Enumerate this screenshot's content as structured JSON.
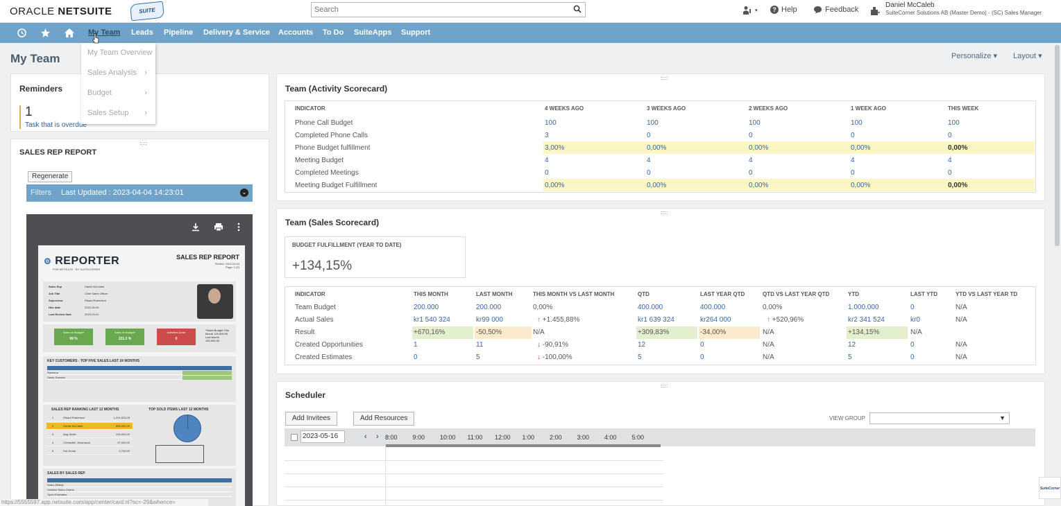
{
  "header": {
    "brand_oracle": "ORACLE",
    "brand_netsuite": "NETSUITE",
    "brand_partner": "SUITE CORNER",
    "search_placeholder": "Search",
    "help_label": "Help",
    "feedback_label": "Feedback",
    "user_name": "Daniel McCaleb",
    "user_role": "SuiteCorner Solutions AB (Master Demo) - (SC) Sales Manager"
  },
  "nav": {
    "items": [
      "My Team",
      "Leads",
      "Pipeline",
      "Delivery & Service",
      "Accounts",
      "To Do",
      "SuiteApps",
      "Support"
    ],
    "dropdown": [
      "My Team Overview",
      "Sales Analysis",
      "Budget",
      "Sales Setup"
    ]
  },
  "page": {
    "title": "My Team",
    "personalize": "Personalize",
    "layout": "Layout"
  },
  "reminders": {
    "title": "Reminders",
    "count": "1",
    "text": "Task that is overdue"
  },
  "sales_rep_report": {
    "title": "SALES REP REPORT",
    "regenerate": "Regenerate",
    "filters": "Filters",
    "last_updated": "Last Updated : 2023-04-04 14:23:01",
    "doc": {
      "logo": "REPORTER",
      "logo_sub": "FOR NETSUITE · BY SUITECORNER",
      "title": "SALES REP REPORT",
      "meta_printed": "Printed: 2023-04-04",
      "meta_page": "Page: 1 (2)",
      "info": [
        {
          "k": "Sales Rep",
          "v": "Daniel McCaleb"
        },
        {
          "k": "Job Title",
          "v": "Chief Sales Officer"
        },
        {
          "k": "Supervisor",
          "v": "Rikard Robertson"
        },
        {
          "k": "Hire date",
          "v": "2022-05-29"
        },
        {
          "k": "Last Review Date",
          "v": "2023-03-01"
        }
      ],
      "kpis": [
        {
          "label": "Sales vs Budget*",
          "value": "99 %",
          "color": "#6aa84f"
        },
        {
          "label": "Sales vs Budget*",
          "value": "221.3 %",
          "color": "#6aa84f"
        },
        {
          "label": "Activities Done",
          "value": "0",
          "color": "#cc4b4b"
        }
      ],
      "kpi_note": "*Sales Budget This Month 120,000.00 Last Month 100,000.00",
      "customers_title": "KEY CUSTOMERS - TOP FIVE SALES LAST 24 MONTHS",
      "customers": [
        "Sanmina",
        "Sarah Samson"
      ],
      "ranking_title": "SALES REP RANKING LAST 12 MONTHS",
      "ranking": [
        {
          "n": "1",
          "name": "Rikard Robertson",
          "val": "1,204,523.28"
        },
        {
          "n": "2",
          "name": "Daniel McCaleb",
          "val": "855,000.00"
        },
        {
          "n": "3",
          "name": "Bog Smith",
          "val": "225,000.00"
        },
        {
          "n": "4",
          "name": "Christoffer Johansson",
          "val": "97,000.00"
        },
        {
          "n": "5",
          "name": "Kai Grune",
          "val": "3,700.00"
        }
      ],
      "top_items_title": "TOP SOLD ITEMS LAST 12 MONTHS",
      "by_rep_title": "SALES BY SALES REP",
      "by_rep_rows": [
        "Sales (Billed)",
        "Unbilled Sales Orders",
        "Open Estimates"
      ]
    }
  },
  "activity": {
    "title": "Team (Activity Scorecard)",
    "headers": [
      "INDICATOR",
      "4 WEEKS AGO",
      "3 WEEKS AGO",
      "2 WEEKS AGO",
      "1 WEEK AGO",
      "THIS WEEK"
    ],
    "rows": [
      [
        "Phone Call Budget",
        "100",
        "100",
        "100",
        "100",
        "100"
      ],
      [
        "Completed Phone Calls",
        "3",
        "0",
        "0",
        "0",
        "0"
      ],
      [
        "Phone Budget fulfillment",
        "3,00%",
        "0,00%",
        "0,00%",
        "0,00%",
        "0,00%"
      ],
      [
        "Meeting Budget",
        "4",
        "4",
        "4",
        "4",
        "4"
      ],
      [
        "Completed Meetings",
        "0",
        "0",
        "0",
        "0",
        "0"
      ],
      [
        "Meeting Budget Fulfillment",
        "0,00%",
        "0,00%",
        "0,00%",
        "0,00%",
        "0,00%"
      ]
    ]
  },
  "sales": {
    "title": "Team (Sales Scorecard)",
    "budget_label": "BUDGET FULFILLMENT (YEAR TO DATE)",
    "budget_value": "+134,15%",
    "headers": [
      "INDICATOR",
      "THIS MONTH",
      "LAST MONTH",
      "THIS MONTH VS LAST MONTH",
      "QTD",
      "LAST YEAR QTD",
      "QTD VS LAST YEAR QTD",
      "YTD",
      "LAST YTD",
      "YTD VS LAST YEAR TD"
    ],
    "rows": [
      [
        "Team Budget",
        "200.000",
        "200.000",
        "0,00%",
        "400.000",
        "400.000",
        "0,00%",
        "1.000.000",
        "0",
        "N/A"
      ],
      [
        "Actual Sales",
        "kr1 540 324",
        "kr99 000",
        "+1.455,88%",
        "kr1 639 324",
        "kr264 000",
        "+520,96%",
        "kr2 341 524",
        "kr0",
        "N/A"
      ],
      [
        "Result",
        "+670,16%",
        "-50,50%",
        "N/A",
        "+309,83%",
        "-34,00%",
        "N/A",
        "+134,15%",
        "N/A",
        ""
      ],
      [
        "Created Opportunities",
        "1",
        "11",
        "-90,91%",
        "12",
        "0",
        "N/A",
        "12",
        "0",
        "N/A"
      ],
      [
        "Created Estimates",
        "0",
        "5",
        "-100,00%",
        "5",
        "0",
        "N/A",
        "5",
        "0",
        "N/A"
      ]
    ]
  },
  "scheduler": {
    "title": "Scheduler",
    "add_invitees": "Add Invitees",
    "add_resources": "Add Resources",
    "view_group": "VIEW GROUP",
    "date": "2023-05-16",
    "times": [
      "8:00",
      "9:00",
      "10:00",
      "11:00",
      "12:00",
      "1:00",
      "2:00",
      "3:00",
      "4:00",
      "5:00"
    ]
  },
  "status_url": "https://5555597.app.netsuite.com/app/center/card.nl?sc=-29&whence="
}
